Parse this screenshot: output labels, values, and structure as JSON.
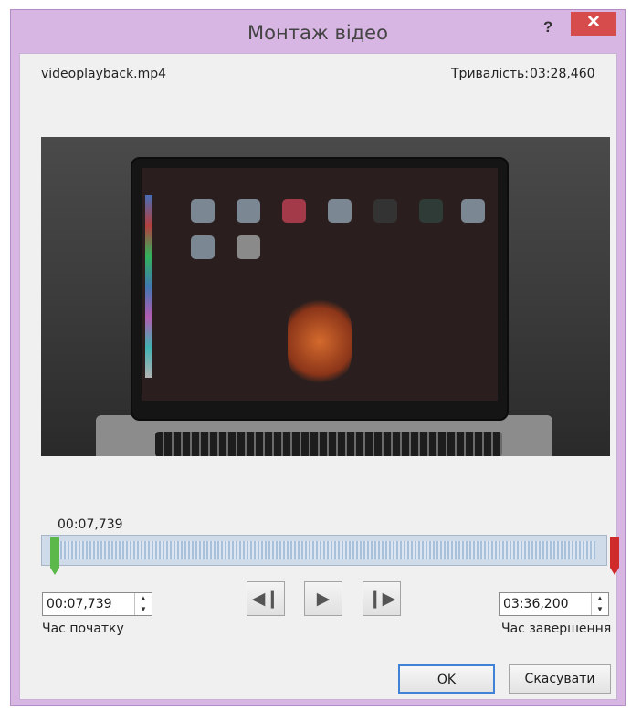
{
  "window": {
    "title": "Монтаж відео",
    "help_label": "?",
    "close_label": "✕"
  },
  "file": {
    "name": "videoplayback.mp4",
    "duration_label": "Тривалість:",
    "duration_value": "03:28,460"
  },
  "timeline": {
    "current_position": "00:07,739",
    "start_fraction": 0.037,
    "end_fraction": 1.0
  },
  "start": {
    "value": "00:07,739",
    "label": "Час початку"
  },
  "end": {
    "value": "03:36,200",
    "label": "Час завершення"
  },
  "playback": {
    "prev_icon": "previous-frame-icon",
    "play_icon": "play-icon",
    "next_icon": "next-frame-icon"
  },
  "buttons": {
    "ok_label": "OK",
    "cancel_label": "Скасувати"
  },
  "colors": {
    "title_bar": "#d8b6e4",
    "close_button": "#d64b4b",
    "start_marker": "#5cb84a",
    "end_marker": "#d02b2b",
    "ok_focus": "#3f82d6"
  }
}
